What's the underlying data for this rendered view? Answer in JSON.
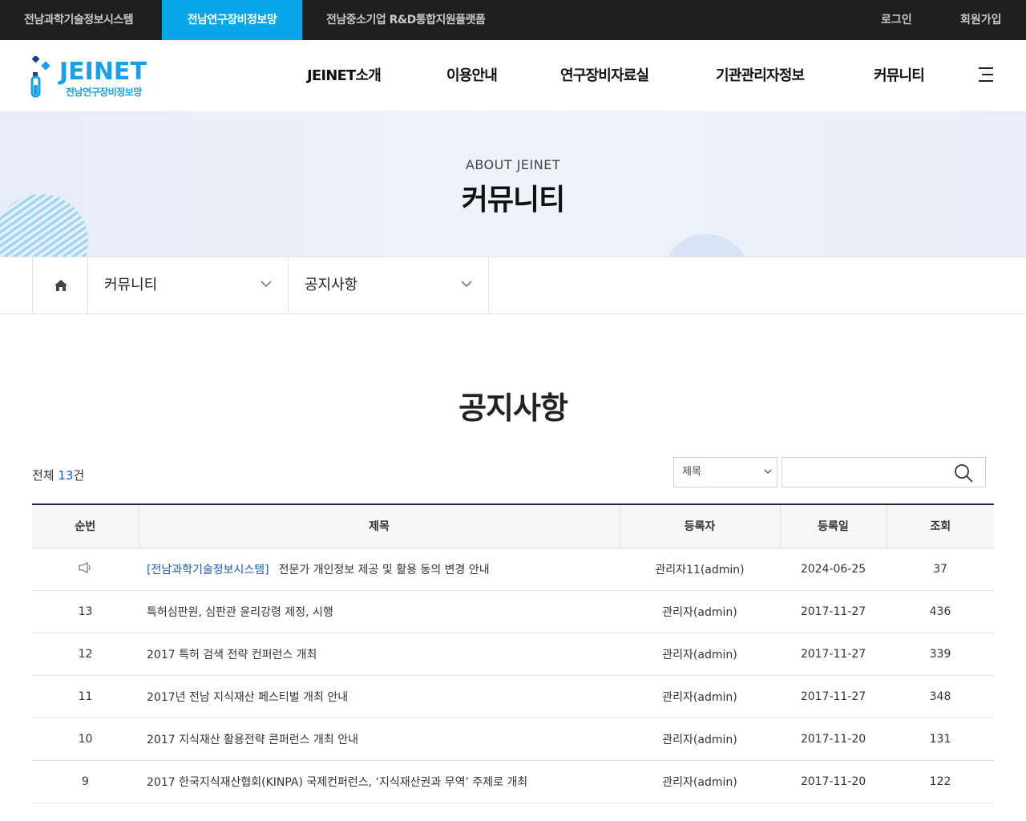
{
  "topbar": {
    "sites": [
      {
        "label": "전남과학기술정보시스템"
      },
      {
        "label": "전남연구장비정보망"
      },
      {
        "label": "전남중소기업 R&D통합지원플랫폼"
      }
    ],
    "login": "로그인",
    "signup": "회원가입"
  },
  "header": {
    "logo_word": "JEINET",
    "logo_sub": "전남연구장비정보망",
    "gnb": [
      "JEINET소개",
      "이용안내",
      "연구장비자료실",
      "기관관리자정보",
      "커뮤니티"
    ]
  },
  "visual": {
    "eyebrow": "ABOUT JEINET",
    "title": "커뮤니티"
  },
  "location": {
    "depth1": "커뮤니티",
    "depth2": "공지사항"
  },
  "board": {
    "title": "공지사항",
    "total_prefix": "전체 ",
    "total_count": "13",
    "total_suffix": "건",
    "search_field": "제목",
    "search_value": "",
    "columns": [
      "순번",
      "제목",
      "등록자",
      "등록일",
      "조회"
    ],
    "notice": {
      "tag": "[전남과학기술정보시스템]",
      "title": "전문가 개인정보 제공 및 활용 동의 변경 안내",
      "writer": "관리자11(admin)",
      "date": "2024-06-25",
      "views": "37"
    },
    "rows": [
      {
        "no": "13",
        "title": "특허심판원, 심판관 윤리강령 제정, 시행",
        "writer": "관리자(admin)",
        "date": "2017-11-27",
        "views": "436"
      },
      {
        "no": "12",
        "title": "2017 특허 검색 전략 컨퍼런스 개최",
        "writer": "관리자(admin)",
        "date": "2017-11-27",
        "views": "339"
      },
      {
        "no": "11",
        "title": "2017년 전남 지식재산 페스티벌 개최 안내",
        "writer": "관리자(admin)",
        "date": "2017-11-27",
        "views": "348"
      },
      {
        "no": "10",
        "title": "2017 지식재산 활용전략 콘퍼런스 개최 안내",
        "writer": "관리자(admin)",
        "date": "2017-11-20",
        "views": "131"
      },
      {
        "no": "9",
        "title": "2017 한국지식재산협회(KINPA) 국제컨퍼런스, ‘지식재산권과 무역’ 주제로 개최",
        "writer": "관리자(admin)",
        "date": "2017-11-20",
        "views": "122"
      }
    ]
  },
  "colors": {
    "topbar_bg": "#1f1f1f",
    "active_site": "#0aa6ea",
    "brand": "#1aa0e6",
    "link_blue": "#1a5ab8",
    "table_top_border": "#1c2b4a"
  },
  "icons": {
    "home": "home-icon",
    "chevron": "chevron-down-icon",
    "search": "search-icon",
    "menu": "hamburger-icon",
    "notice": "megaphone-icon"
  }
}
